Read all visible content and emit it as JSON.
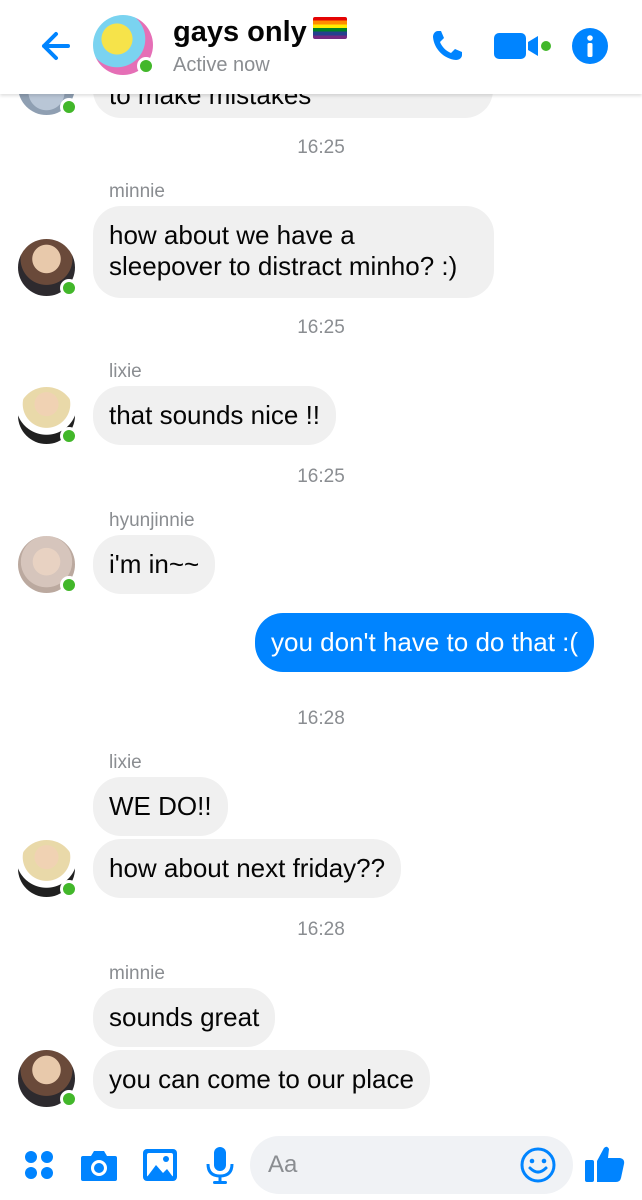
{
  "header": {
    "title": "gays only",
    "status": "Active now",
    "icons": [
      "back-arrow-icon",
      "phone-icon",
      "video-camera-icon",
      "info-icon"
    ]
  },
  "colors": {
    "accent": "#0084ff",
    "online": "#42b72a",
    "incoming_bubble": "#f0f0f0",
    "timestamp": "#8a8d91"
  },
  "messages": {
    "partial_text": "to make mistakes",
    "t1": "16:25",
    "m1_sender": "minnie",
    "m1_line1": "how about we have a",
    "m1_line2": "sleepover to distract minho? :)",
    "t2": "16:25",
    "m2_sender": "lixie",
    "m2_text": "that sounds nice !!",
    "t3": "16:25",
    "m3_sender": "hyunjinnie",
    "m3_text": "i'm in~~",
    "out1": "you don't have to do that :(",
    "t4": "16:28",
    "m4_sender": "lixie",
    "m4_text1": "WE DO!!",
    "m4_text2": "how about next friday??",
    "t5": "16:28",
    "m5_sender": "minnie",
    "m5_text1": "sounds great",
    "m5_text2": "you can come to our place"
  },
  "composer": {
    "placeholder": "Aa",
    "icons": [
      "more-actions-icon",
      "camera-icon",
      "gallery-icon",
      "microphone-icon",
      "emoji-icon",
      "thumbs-up-icon"
    ]
  }
}
